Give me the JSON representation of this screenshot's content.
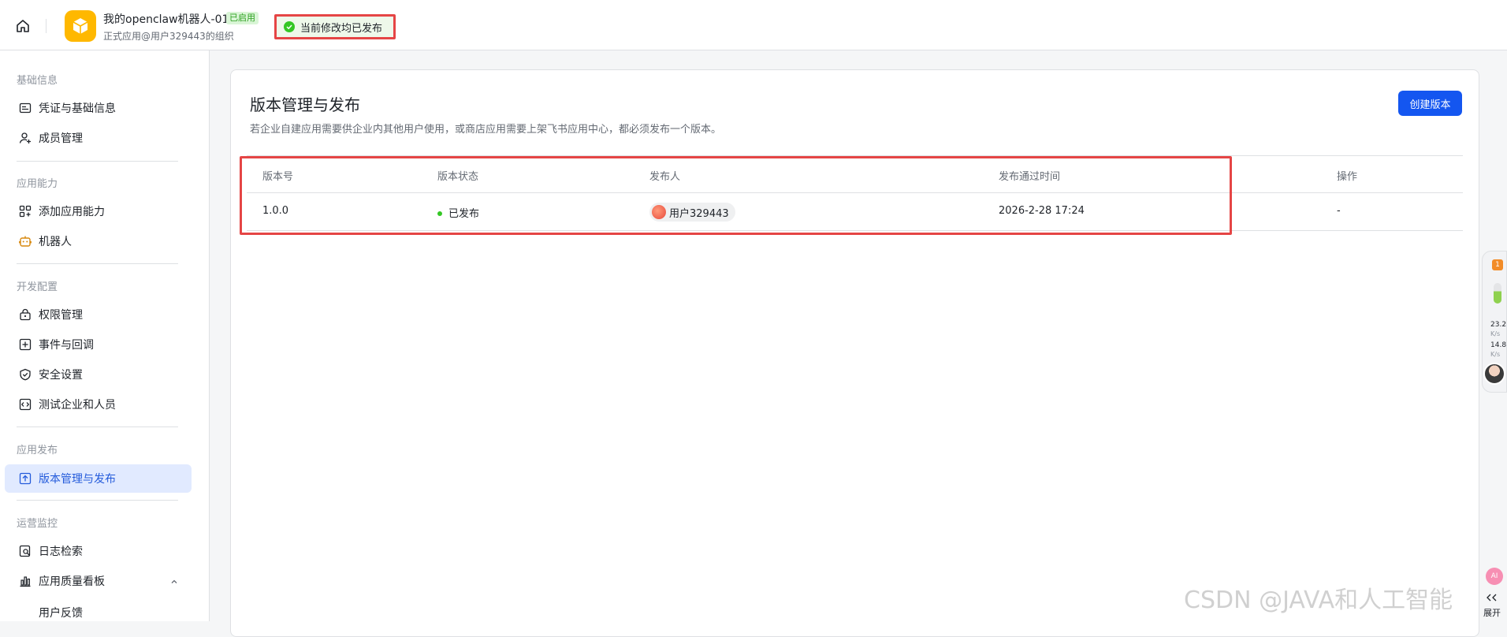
{
  "topbar": {
    "app_name": "我的openclaw机器人-01",
    "enabled_badge": "已启用",
    "app_subtitle": "正式应用@用户329443的组织",
    "publish_status": "当前修改均已发布"
  },
  "sidebar": {
    "groups": [
      {
        "title": "基础信息",
        "items": [
          {
            "label": "凭证与基础信息",
            "icon": "credential-icon"
          },
          {
            "label": "成员管理",
            "icon": "member-icon"
          }
        ]
      },
      {
        "title": "应用能力",
        "items": [
          {
            "label": "添加应用能力",
            "icon": "grid-add-icon"
          },
          {
            "label": "机器人",
            "icon": "robot-icon"
          }
        ]
      },
      {
        "title": "开发配置",
        "items": [
          {
            "label": "权限管理",
            "icon": "lock-icon"
          },
          {
            "label": "事件与回调",
            "icon": "event-icon"
          },
          {
            "label": "安全设置",
            "icon": "shield-icon"
          },
          {
            "label": "测试企业和人员",
            "icon": "code-icon"
          }
        ]
      },
      {
        "title": "应用发布",
        "items": [
          {
            "label": "版本管理与发布",
            "icon": "upload-icon",
            "active": true
          }
        ]
      },
      {
        "title": "运营监控",
        "items": [
          {
            "label": "日志检索",
            "icon": "log-search-icon"
          },
          {
            "label": "应用质量看板",
            "icon": "bar-chart-icon",
            "expanded": true
          }
        ],
        "sub_items": [
          "用户反馈"
        ]
      }
    ]
  },
  "main": {
    "title": "版本管理与发布",
    "description": "若企业自建应用需要供企业内其他用户使用，或商店应用需要上架飞书应用中心，都必须发布一个版本。",
    "create_button": "创建版本",
    "table": {
      "columns": [
        "版本号",
        "版本状态",
        "发布人",
        "发布通过时间",
        "操作"
      ],
      "rows": [
        {
          "version": "1.0.0",
          "status": "已发布",
          "publisher": "用户329443",
          "time": "2026-2-28 17:24",
          "action": "-"
        }
      ]
    }
  },
  "float_widget": {
    "badge": "1",
    "upload_speed": "23.2",
    "upload_unit": "K/s",
    "download_speed": "14.8",
    "download_unit": "K/s"
  },
  "expand_button": {
    "ai_label": "AI",
    "label": "展开"
  },
  "watermark": "CSDN @JAVA和人工智能",
  "colors": {
    "primary": "#1456f0",
    "active_bg": "#e1eaff",
    "active_text": "#245bdb",
    "success": "#34c724",
    "highlight_border": "#e54545",
    "logo": "#ffb800"
  }
}
